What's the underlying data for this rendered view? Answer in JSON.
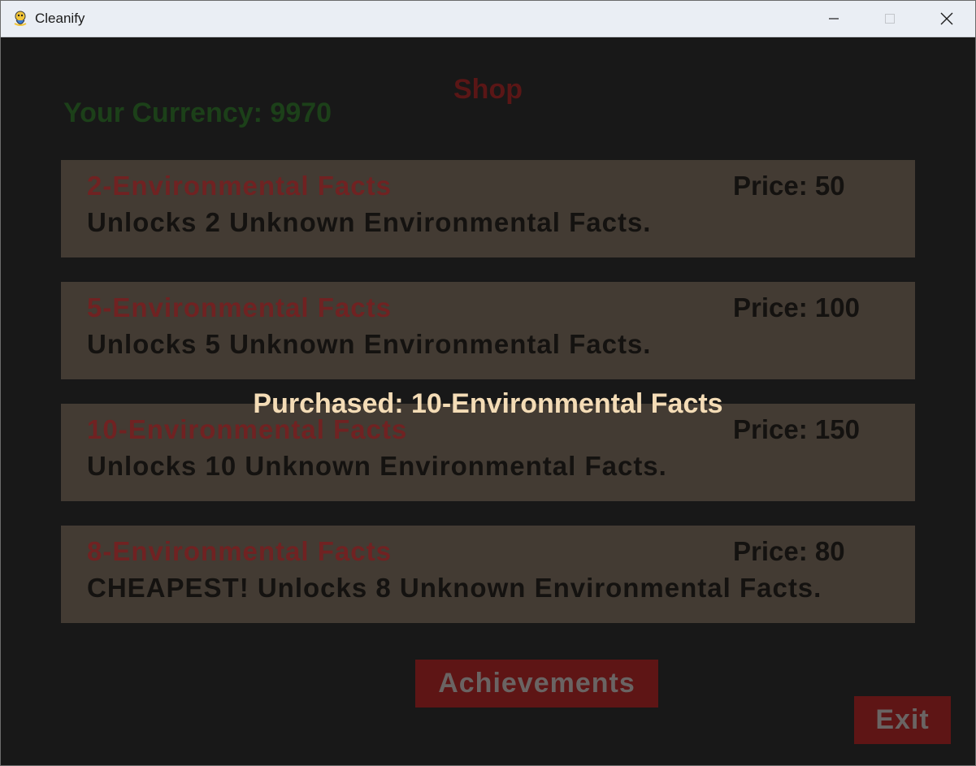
{
  "window": {
    "title": "Cleanify",
    "app_icon": "python-snake-icon"
  },
  "shop": {
    "title": "Shop",
    "currency_text": "Your Currency: 9970"
  },
  "items": [
    {
      "title": "2-Environmental Facts",
      "price": "Price: 50",
      "description": "Unlocks 2 Unknown Environmental Facts."
    },
    {
      "title": "5-Environmental Facts",
      "price": "Price: 100",
      "description": "Unlocks 5 Unknown Environmental Facts."
    },
    {
      "title": "10-Environmental Facts",
      "price": "Price: 150",
      "description": "Unlocks 10 Unknown Environmental Facts."
    },
    {
      "title": "8-Environmental Facts",
      "price": "Price: 80",
      "description": "CHEAPEST! Unlocks 8 Unknown Environmental Facts."
    }
  ],
  "notification": {
    "text": "Purchased: 10-Environmental Facts"
  },
  "buttons": {
    "achievements": "Achievements",
    "exit": "Exit"
  },
  "colors": {
    "background": "#181818",
    "card": "#433b33",
    "item_title": "#702222",
    "currency": "#1c4019",
    "shop_title": "#5a1616",
    "notification": "#f4dcb6",
    "button_bg": "#5e1515"
  }
}
